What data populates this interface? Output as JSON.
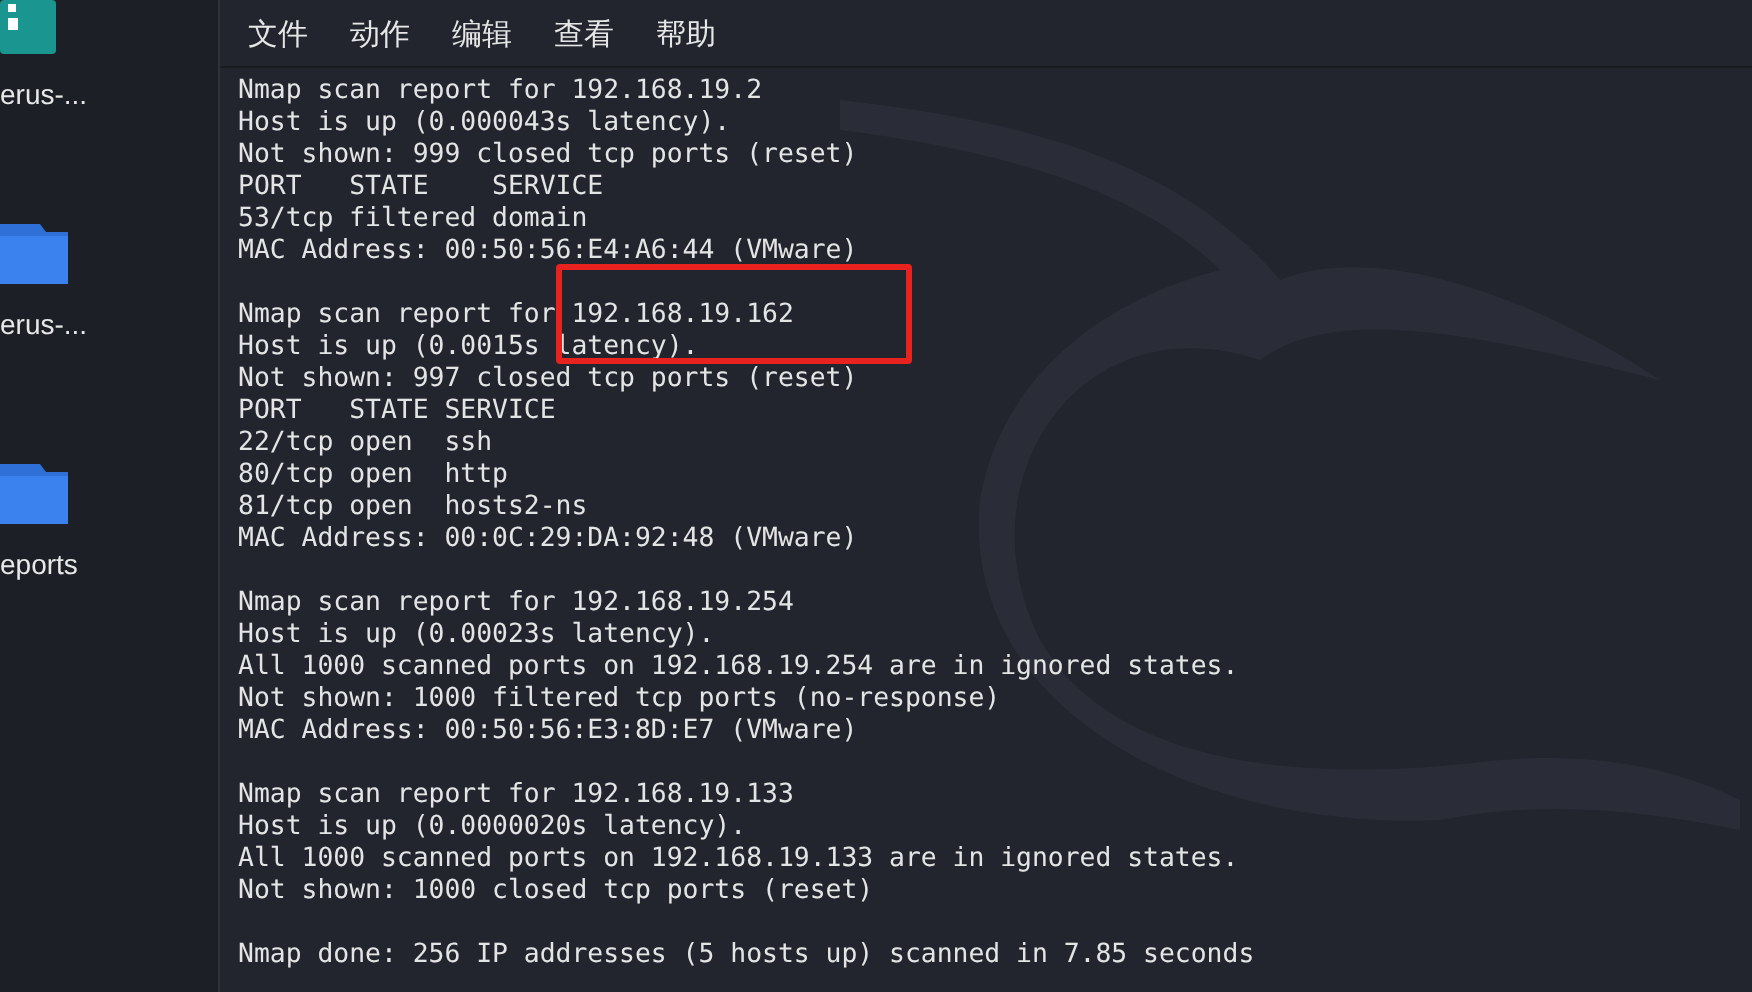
{
  "desktop_icons": [
    {
      "kind": "app",
      "label": "erus-..."
    },
    {
      "kind": "folder",
      "label": "erus-..."
    },
    {
      "kind": "folder",
      "label": "eports"
    }
  ],
  "menu": [
    "文件",
    "动作",
    "编辑",
    "查看",
    "帮助"
  ],
  "terminal": {
    "blocks": [
      [
        "Nmap scan report for 192.168.19.2",
        "Host is up (0.000043s latency).",
        "Not shown: 999 closed tcp ports (reset)",
        "PORT   STATE    SERVICE",
        "53/tcp filtered domain",
        "MAC Address: 00:50:56:E4:A6:44 (VMware)"
      ],
      [
        "Nmap scan report for 192.168.19.162",
        "Host is up (0.0015s latency).",
        "Not shown: 997 closed tcp ports (reset)",
        "PORT   STATE SERVICE",
        "22/tcp open  ssh",
        "80/tcp open  http",
        "81/tcp open  hosts2-ns",
        "MAC Address: 00:0C:29:DA:92:48 (VMware)"
      ],
      [
        "Nmap scan report for 192.168.19.254",
        "Host is up (0.00023s latency).",
        "All 1000 scanned ports on 192.168.19.254 are in ignored states.",
        "Not shown: 1000 filtered tcp ports (no-response)",
        "MAC Address: 00:50:56:E3:8D:E7 (VMware)"
      ],
      [
        "Nmap scan report for 192.168.19.133",
        "Host is up (0.0000020s latency).",
        "All 1000 scanned ports on 192.168.19.133 are in ignored states.",
        "Not shown: 1000 closed tcp ports (reset)"
      ],
      [
        "Nmap done: 256 IP addresses (5 hosts up) scanned in 7.85 seconds"
      ]
    ],
    "annotation": {
      "kind": "rectangle",
      "color": "#e8231f"
    }
  }
}
